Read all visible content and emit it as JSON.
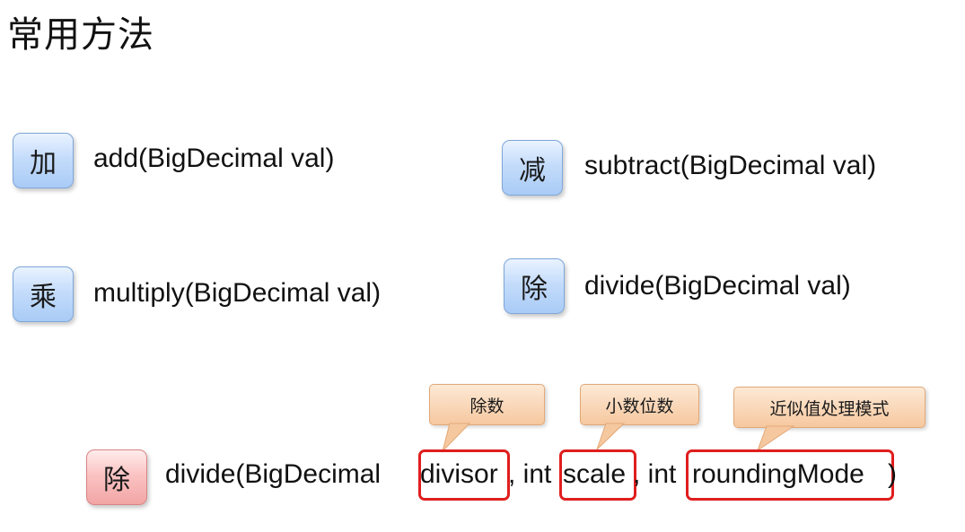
{
  "title": "常用方法",
  "methods": [
    {
      "badge": "加",
      "signature": "add(BigDecimal val)"
    },
    {
      "badge": "减",
      "signature": "subtract(BigDecimal val)"
    },
    {
      "badge": "乘",
      "signature": "multiply(BigDecimal val)"
    },
    {
      "badge": "除",
      "signature": "divide(BigDecimal val)"
    }
  ],
  "divide_full": {
    "badge": "除",
    "prefix": "divide(BigDecimal ",
    "param1": "divisor",
    "sep1": ", int ",
    "param2": "scale",
    "sep2": ", int ",
    "param3": "roundingMode",
    "suffix": ")",
    "callouts": [
      "除数",
      "小数位数",
      "近似值处理模式"
    ]
  },
  "colors": {
    "blue_badge": "#bcd6f8",
    "red_badge": "#f8b9b9",
    "callout": "#f8d2b0",
    "highlight": "#e01e1e"
  }
}
